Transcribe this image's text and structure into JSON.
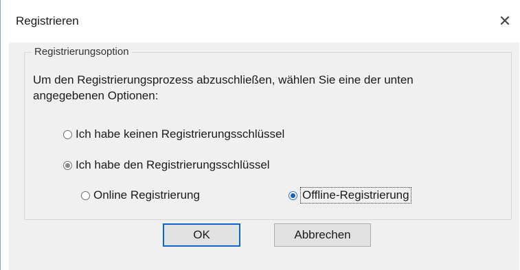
{
  "window": {
    "title": "Registrieren",
    "close_glyph": "✕"
  },
  "group": {
    "legend": "Registrierungsoption",
    "instruction": "Um den Registrierungsprozess abzuschließen, wählen Sie eine der unten angegebenen Optionen:"
  },
  "options": {
    "no_key": {
      "label": "Ich habe keinen Registrierungsschlüssel",
      "selected": false
    },
    "have_key": {
      "label": "Ich habe den Registrierungsschlüssel",
      "selected": true
    },
    "online": {
      "label": "Online  Registrierung",
      "selected": false
    },
    "offline": {
      "label": "Offline-Registrierung",
      "selected": true
    }
  },
  "buttons": {
    "ok": "OK",
    "cancel": "Abbrechen"
  },
  "colors": {
    "accent": "#0a66cc",
    "radio_selected": "#1f5fbf",
    "dialog_background": "#f0f0f0"
  },
  "icons": {
    "close": "close-icon"
  }
}
